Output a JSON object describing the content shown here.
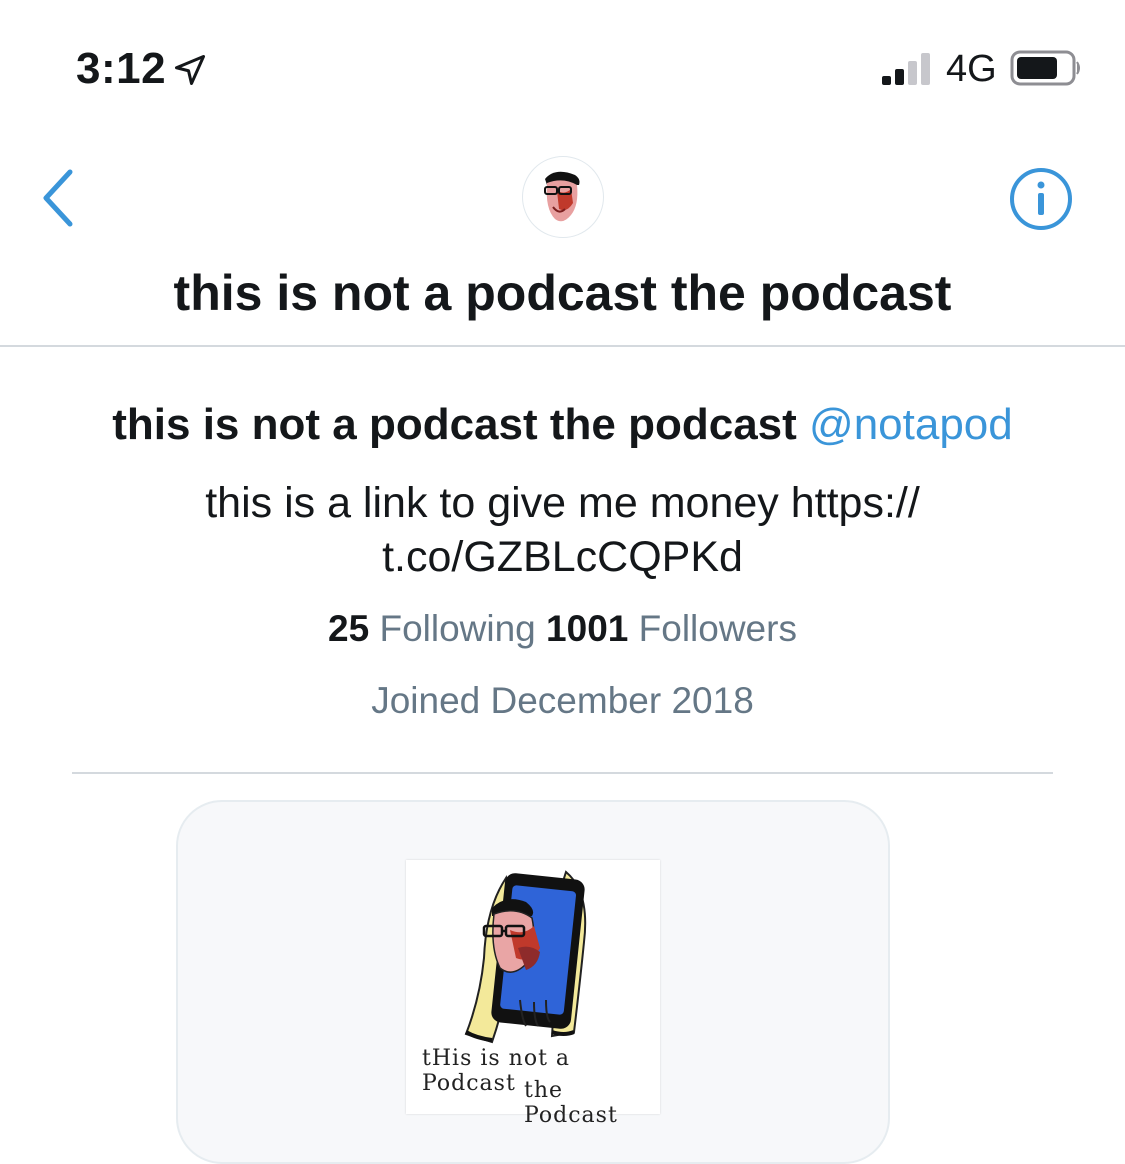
{
  "status_bar": {
    "time": "3:12",
    "network": "4G",
    "icons": [
      "location-arrow-icon",
      "signal-bars-icon",
      "battery-icon"
    ]
  },
  "header": {
    "title": "this is not a podcast the podcast",
    "icons": [
      "back-chevron-icon",
      "info-icon"
    ]
  },
  "profile": {
    "name": "this is not a podcast the podcast",
    "handle": "@notapod",
    "bio": "this is a link to give me money https:// t.co/GZBLcCQPKd",
    "following_count": "25",
    "following_label": "Following",
    "followers_count": "1001",
    "followers_label": "Followers",
    "joined": "Joined December 2018"
  },
  "media_card": {
    "art_line1": "tHis is not a Podcast",
    "art_line2": "the Podcast"
  },
  "colors": {
    "accent": "#3a95d9",
    "text": "#14171a",
    "secondary_text": "#657786",
    "divider": "#d4d9de"
  }
}
